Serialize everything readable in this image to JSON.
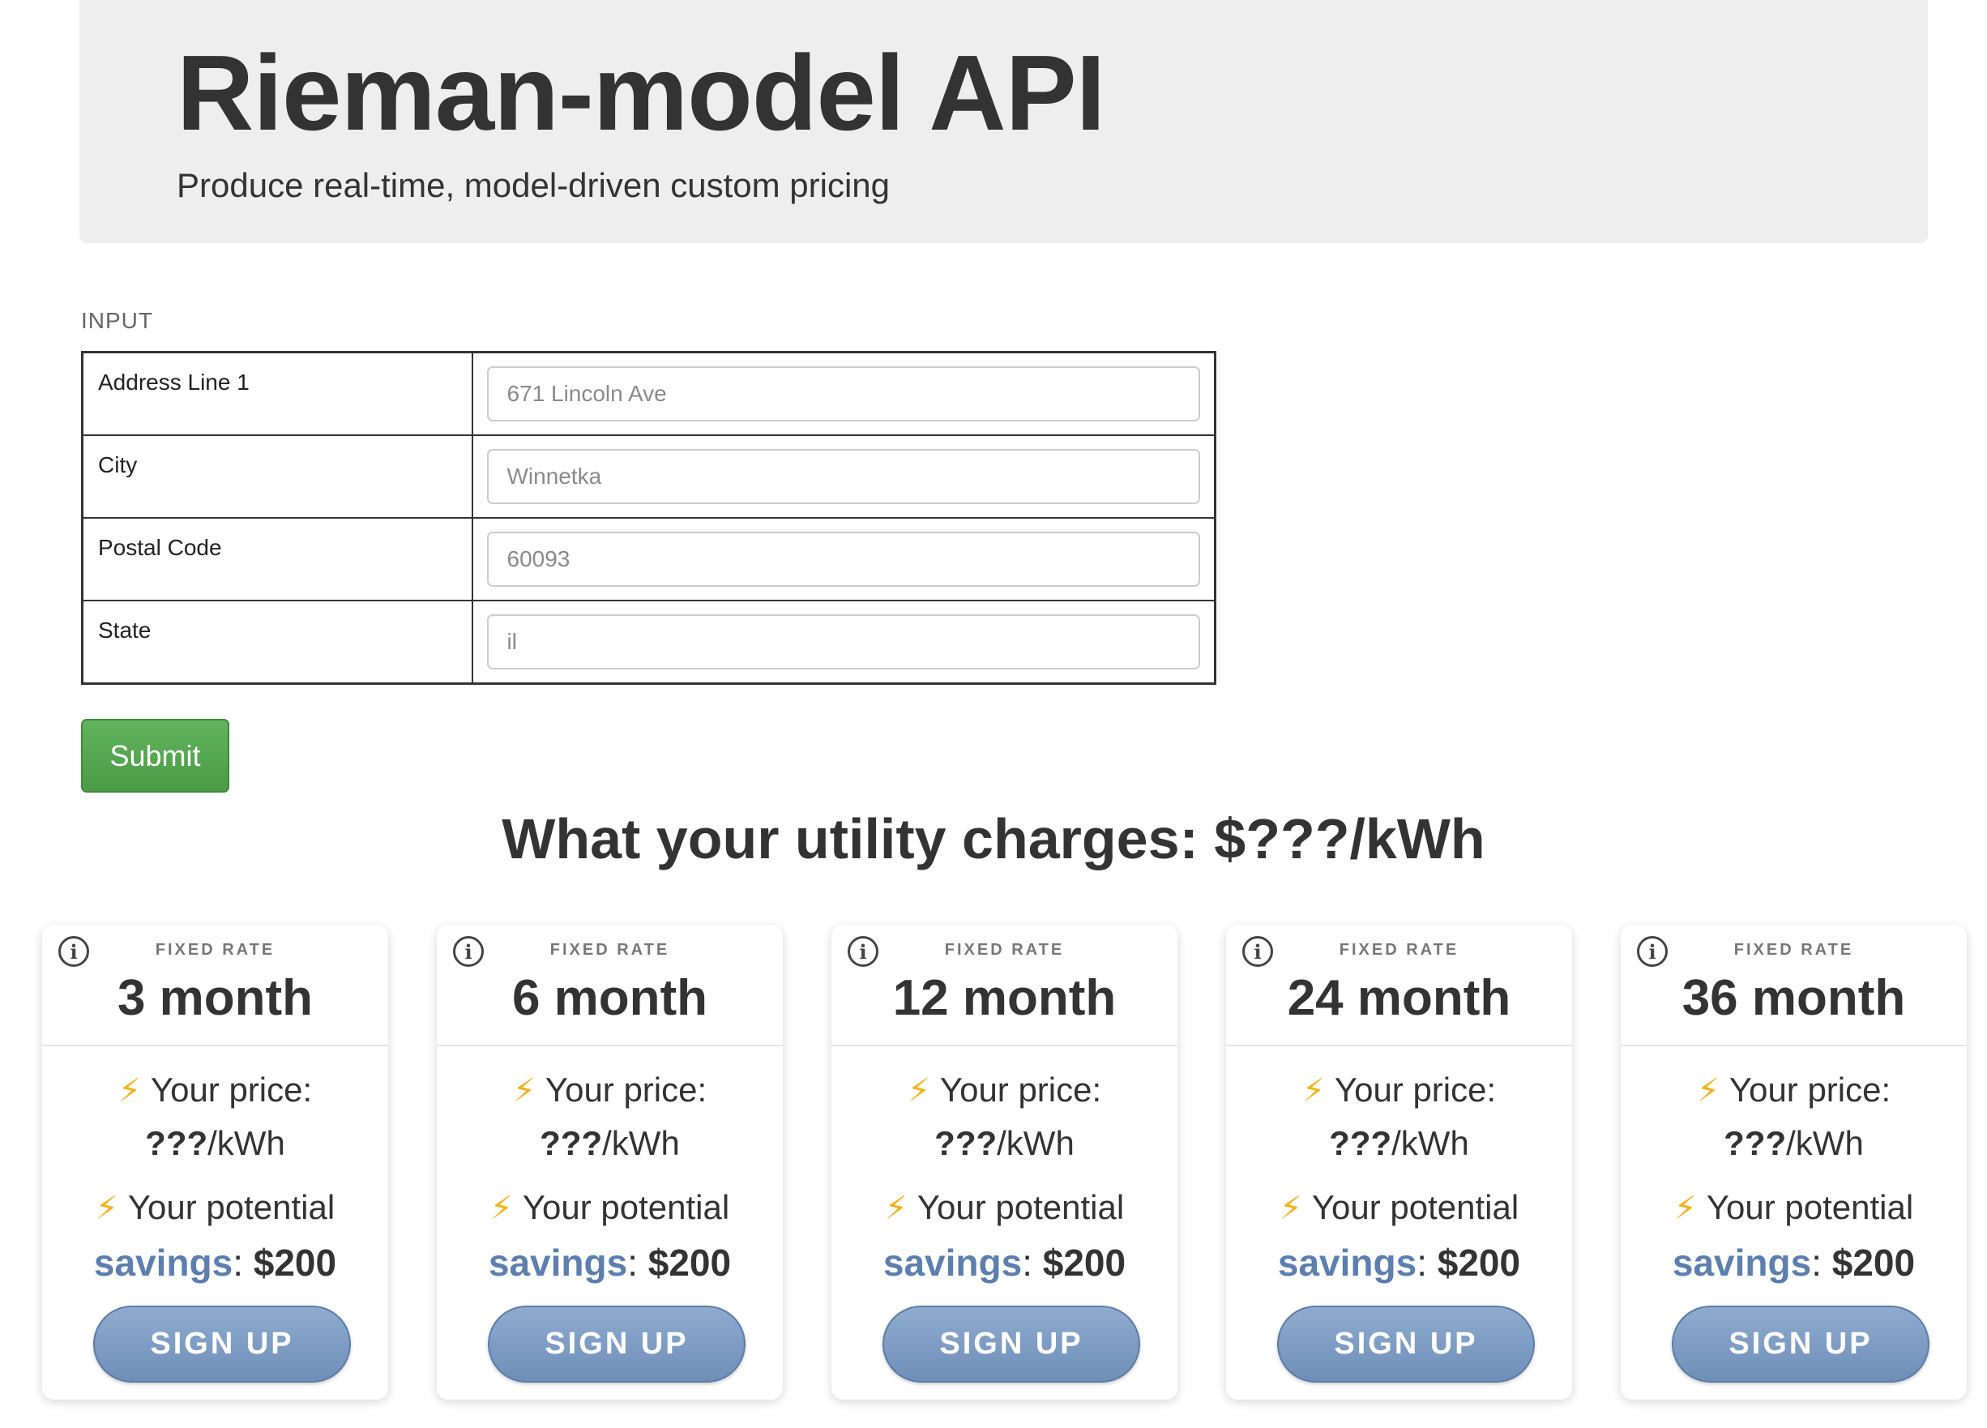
{
  "header": {
    "title": "Rieman-model API",
    "subtitle": "Produce real-time, model-driven custom pricing"
  },
  "input": {
    "caption": "INPUT",
    "fields": [
      {
        "label": "Address Line 1",
        "placeholder": "671 Lincoln Ave"
      },
      {
        "label": "City",
        "placeholder": "Winnetka"
      },
      {
        "label": "Postal Code",
        "placeholder": "60093"
      },
      {
        "label": "State",
        "placeholder": "il"
      }
    ],
    "submit_label": "Submit"
  },
  "utility_heading": "What your utility charges: $???/kWh",
  "plans": [
    {
      "kicker": "FIXED RATE",
      "term": "3 month",
      "price_label": "Your price:",
      "price": "???",
      "price_unit": "/kWh",
      "savings_pre": "Your potential",
      "savings_word": "savings",
      "savings_amount": "$200",
      "cta": "SIGN UP"
    },
    {
      "kicker": "FIXED RATE",
      "term": "6 month",
      "price_label": "Your price:",
      "price": "???",
      "price_unit": "/kWh",
      "savings_pre": "Your potential",
      "savings_word": "savings",
      "savings_amount": "$200",
      "cta": "SIGN UP"
    },
    {
      "kicker": "FIXED RATE",
      "term": "12 month",
      "price_label": "Your price:",
      "price": "???",
      "price_unit": "/kWh",
      "savings_pre": "Your potential",
      "savings_word": "savings",
      "savings_amount": "$200",
      "cta": "SIGN UP"
    },
    {
      "kicker": "FIXED RATE",
      "term": "24 month",
      "price_label": "Your price:",
      "price": "???",
      "price_unit": "/kWh",
      "savings_pre": "Your potential",
      "savings_word": "savings",
      "savings_amount": "$200",
      "cta": "SIGN UP"
    },
    {
      "kicker": "FIXED RATE",
      "term": "36 month",
      "price_label": "Your price:",
      "price": "???",
      "price_unit": "/kWh",
      "savings_pre": "Your potential",
      "savings_word": "savings",
      "savings_amount": "$200",
      "cta": "SIGN UP"
    }
  ],
  "icons": {
    "info": "info-icon",
    "bolt": "lightning-bolt-icon"
  },
  "colors": {
    "submit": "#5cb85c",
    "signup": "#7e9cc4",
    "savings": "#5d7fae",
    "bolt": "#f2b21b",
    "header_bg": "#eeeeee"
  }
}
